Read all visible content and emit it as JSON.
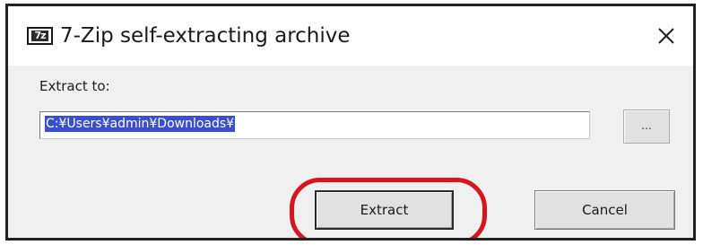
{
  "window": {
    "icon_text": "7z",
    "title": "7-Zip self-extracting archive",
    "close_glyph": "×"
  },
  "form": {
    "extract_to_label": "Extract to:",
    "path_value": "C:¥Users¥admin¥Downloads¥",
    "browse_label": "..."
  },
  "buttons": {
    "extract_label": "Extract",
    "cancel_label": "Cancel"
  },
  "annotation": {
    "ring_color": "#d8151f",
    "highlight_target": "extract-button"
  },
  "colors": {
    "selection": "#3a4fd0",
    "dialog_background": "#f0f0f0"
  },
  "icons": {
    "app": "7zip-icon",
    "close": "close-icon"
  }
}
